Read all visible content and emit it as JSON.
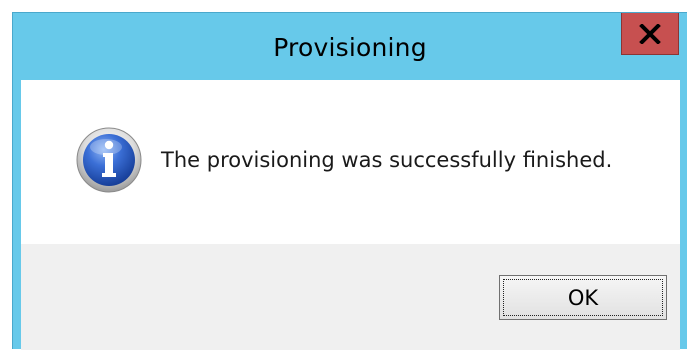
{
  "dialog": {
    "title": "Provisioning",
    "close_label": "X",
    "close_icon": "close-icon",
    "info_icon": "info-icon",
    "message": "The provisioning was successfully finished.",
    "ok_label": "OK"
  },
  "colors": {
    "titlebar": "#67c9ea",
    "close_button": "#c75050",
    "content_background": "#ffffff",
    "button_area_background": "#f0f0f0",
    "icon_blue": "#2d5fc4"
  }
}
